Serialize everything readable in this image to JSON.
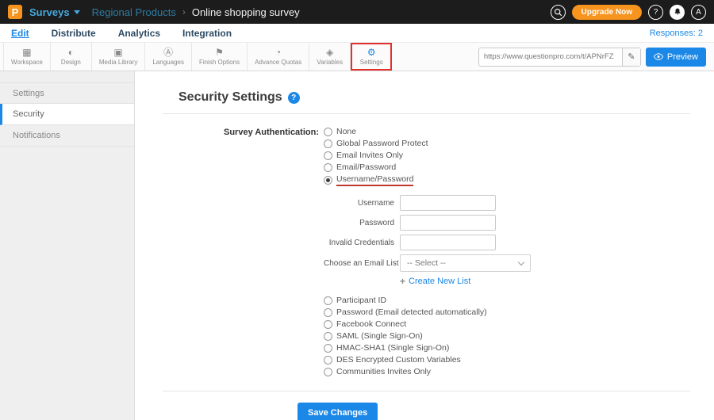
{
  "colors": {
    "accent_blue": "#1b87e6",
    "brand_orange": "#f7941e",
    "annotation_red": "#e0312d"
  },
  "icons": {
    "pencil": "✎",
    "plus": "+"
  },
  "topbar": {
    "logo_letter": "P",
    "app_menu": "Surveys",
    "breadcrumb_parent": "Regional Products",
    "breadcrumb_separator": "›",
    "breadcrumb_current": "Online shopping survey",
    "upgrade_label": "Upgrade Now",
    "help_label": "?",
    "avatar_letter": "A"
  },
  "navbar": {
    "items": [
      {
        "label": "Edit"
      },
      {
        "label": "Distribute"
      },
      {
        "label": "Analytics"
      },
      {
        "label": "Integration"
      }
    ],
    "responses_label": "Responses: 2"
  },
  "toolbar": {
    "items": [
      {
        "label": "Workspace",
        "icon": "▦"
      },
      {
        "label": "Design",
        "icon": "◐"
      },
      {
        "label": "Media Library",
        "icon": "▣"
      },
      {
        "label": "Languages",
        "icon": "Ⓐ"
      },
      {
        "label": "Finish Options",
        "icon": "⚑"
      },
      {
        "label": "Advance Quotas",
        "icon": "◔"
      },
      {
        "label": "Variables",
        "icon": "◈"
      },
      {
        "label": "Settings",
        "icon": "⚙"
      }
    ],
    "url_value": "https://www.questionpro.com/t/APNrFZ",
    "preview_label": "Preview"
  },
  "sidebar": {
    "items": [
      {
        "label": "Settings"
      },
      {
        "label": "Security"
      },
      {
        "label": "Notifications"
      }
    ]
  },
  "content": {
    "title": "Security Settings",
    "help_icon": "?",
    "auth_label": "Survey Authentication:",
    "auth_options_top": [
      "None",
      "Global Password Protect",
      "Email Invites Only",
      "Email/Password",
      "Username/Password"
    ],
    "selected_option": "Username/Password",
    "fields": {
      "username_label": "Username",
      "password_label": "Password",
      "invalid_credentials_label": "Invalid Credentials",
      "email_list_label": "Choose an Email List",
      "email_list_value": "-- Select --",
      "create_new_list_label": "Create New List"
    },
    "auth_options_bottom": [
      "Participant ID",
      "Password (Email detected automatically)",
      "Facebook Connect",
      "SAML (Single Sign-On)",
      "HMAC-SHA1 (Single Sign-On)",
      "DES Encrypted Custom Variables",
      "Communities Invites Only"
    ],
    "save_label": "Save Changes"
  }
}
